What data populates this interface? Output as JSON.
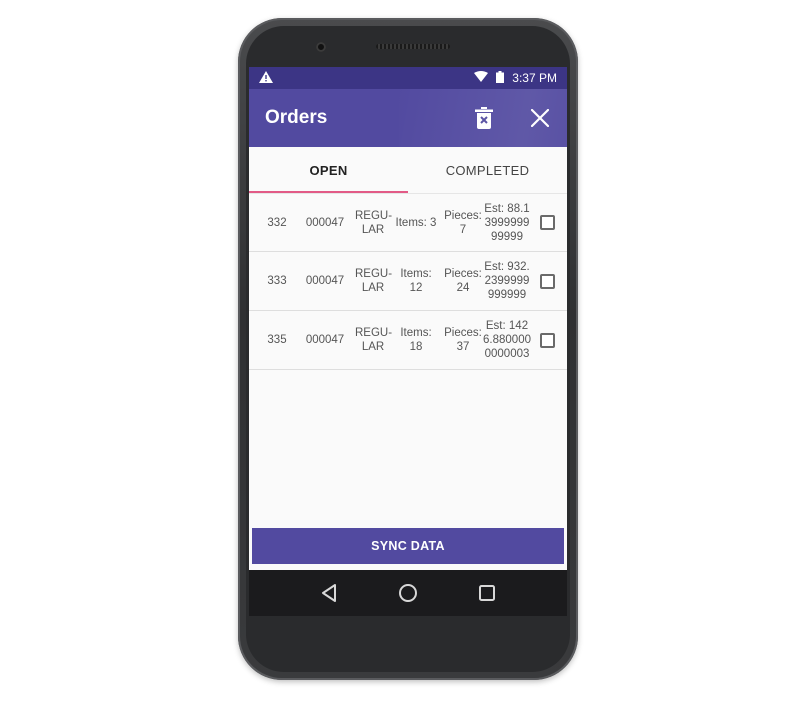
{
  "status_bar": {
    "time": "3:37 PM",
    "icons": [
      "warning-icon",
      "wifi-icon",
      "battery-icon"
    ]
  },
  "app_bar": {
    "title": "Orders",
    "actions": [
      "delete-icon",
      "close-icon"
    ]
  },
  "tabs": [
    {
      "label": "OPEN",
      "active": true
    },
    {
      "label": "COMPLETED",
      "active": false
    }
  ],
  "orders": [
    {
      "id": "332",
      "account": "000047",
      "type": "REGU-LAR",
      "items": "Items: 3",
      "pieces": "Pieces: 7",
      "est": "Est: 88.1399999999999",
      "checked": false
    },
    {
      "id": "333",
      "account": "000047",
      "type": "REGU-LAR",
      "items": "Items: 12",
      "pieces": "Pieces: 24",
      "est": "Est: 932.2399999999999",
      "checked": false
    },
    {
      "id": "335",
      "account": "000047",
      "type": "REGU-LAR",
      "items": "Items: 18",
      "pieces": "Pieces: 37",
      "est": "Est: 1426.8800000000003",
      "checked": false
    }
  ],
  "sync_button": {
    "label": "SYNC DATA"
  },
  "nav_bar": {
    "buttons": [
      "back-icon",
      "home-icon",
      "recents-icon"
    ]
  },
  "colors": {
    "status_bar": "#3c3585",
    "app_bar": "#524aa0",
    "tab_indicator": "#e25a86",
    "sync_button": "#524aa0",
    "nav_bar": "#1b1b1d"
  }
}
